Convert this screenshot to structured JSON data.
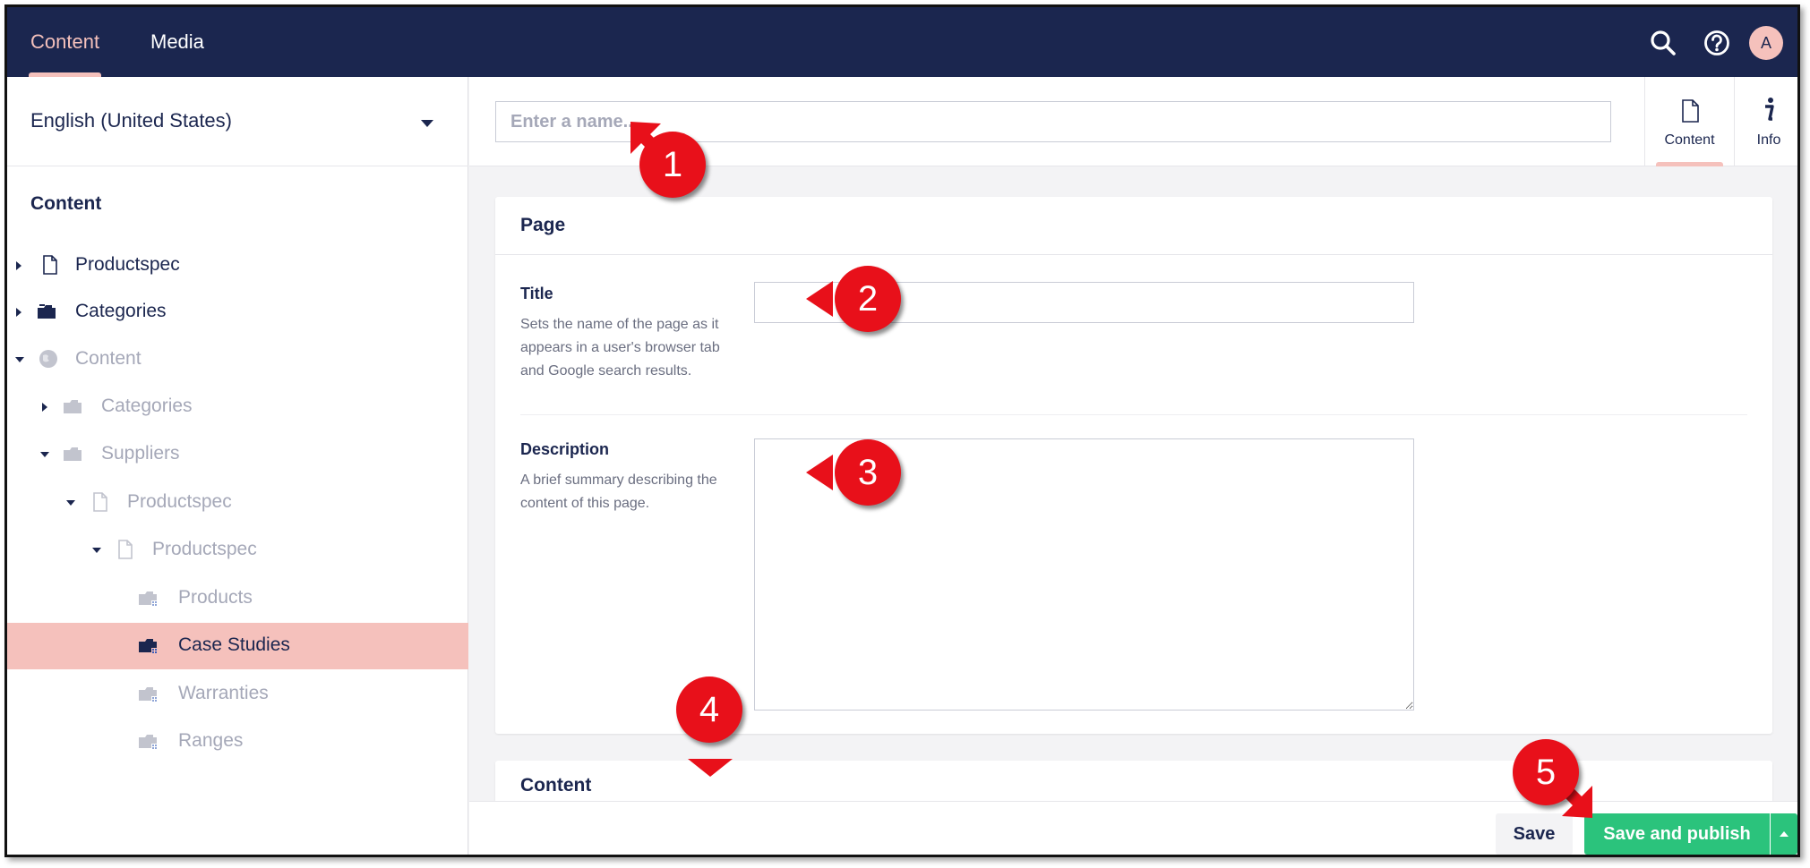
{
  "topbar": {
    "tabs": [
      {
        "label": "Content",
        "active": true
      },
      {
        "label": "Media",
        "active": false
      }
    ],
    "icons": [
      "search-icon",
      "help-icon"
    ],
    "avatar_initial": "A"
  },
  "sidebar": {
    "language": "English (United States)",
    "tree_heading": "Content",
    "items": [
      {
        "label": "Productspec",
        "icon": "document-icon",
        "caret": "right",
        "muted": false
      },
      {
        "label": "Categories",
        "icon": "folder-icon",
        "caret": "right",
        "muted": false
      },
      {
        "label": "Content",
        "icon": "globe-icon",
        "caret": "down",
        "muted": true
      },
      {
        "label": "Categories",
        "icon": "folder-icon",
        "caret": "right",
        "muted": true
      },
      {
        "label": "Suppliers",
        "icon": "folder-icon",
        "caret": "down",
        "muted": true
      },
      {
        "label": "Productspec",
        "icon": "document-icon",
        "caret": "down",
        "muted": true
      },
      {
        "label": "Productspec",
        "icon": "document-icon",
        "caret": "down",
        "muted": true
      },
      {
        "label": "Products",
        "icon": "folder-grid-icon",
        "caret": "none",
        "muted": true
      },
      {
        "label": "Case Studies",
        "icon": "folder-grid-icon",
        "caret": "none",
        "muted": false,
        "selected": true
      },
      {
        "label": "Warranties",
        "icon": "folder-grid-icon",
        "caret": "none",
        "muted": true
      },
      {
        "label": "Ranges",
        "icon": "folder-grid-icon",
        "caret": "none",
        "muted": true
      }
    ]
  },
  "editor": {
    "name_placeholder": "Enter a name...",
    "app_tabs": [
      {
        "label": "Content",
        "icon": "document-icon",
        "active": true
      },
      {
        "label": "Info",
        "icon": "info-icon",
        "active": false
      }
    ],
    "page_group": {
      "title": "Page",
      "title_prop": {
        "label": "Title",
        "description": "Sets the name of the page as it appears in a user's browser tab and Google search results.",
        "value": ""
      },
      "description_prop": {
        "label": "Description",
        "description": "A brief summary describing the content of this page.",
        "value": ""
      }
    },
    "content_group": {
      "title": "Content"
    }
  },
  "footer": {
    "save_label": "Save",
    "publish_label": "Save and publish"
  },
  "callouts": {
    "c1": "1",
    "c2": "2",
    "c3": "3",
    "c4": "4",
    "c5": "5"
  },
  "colors": {
    "topbar": "#1b264f",
    "accent_pink": "#f5c1bc",
    "publish_green": "#2bc37c",
    "callout_red": "#e8101a"
  }
}
